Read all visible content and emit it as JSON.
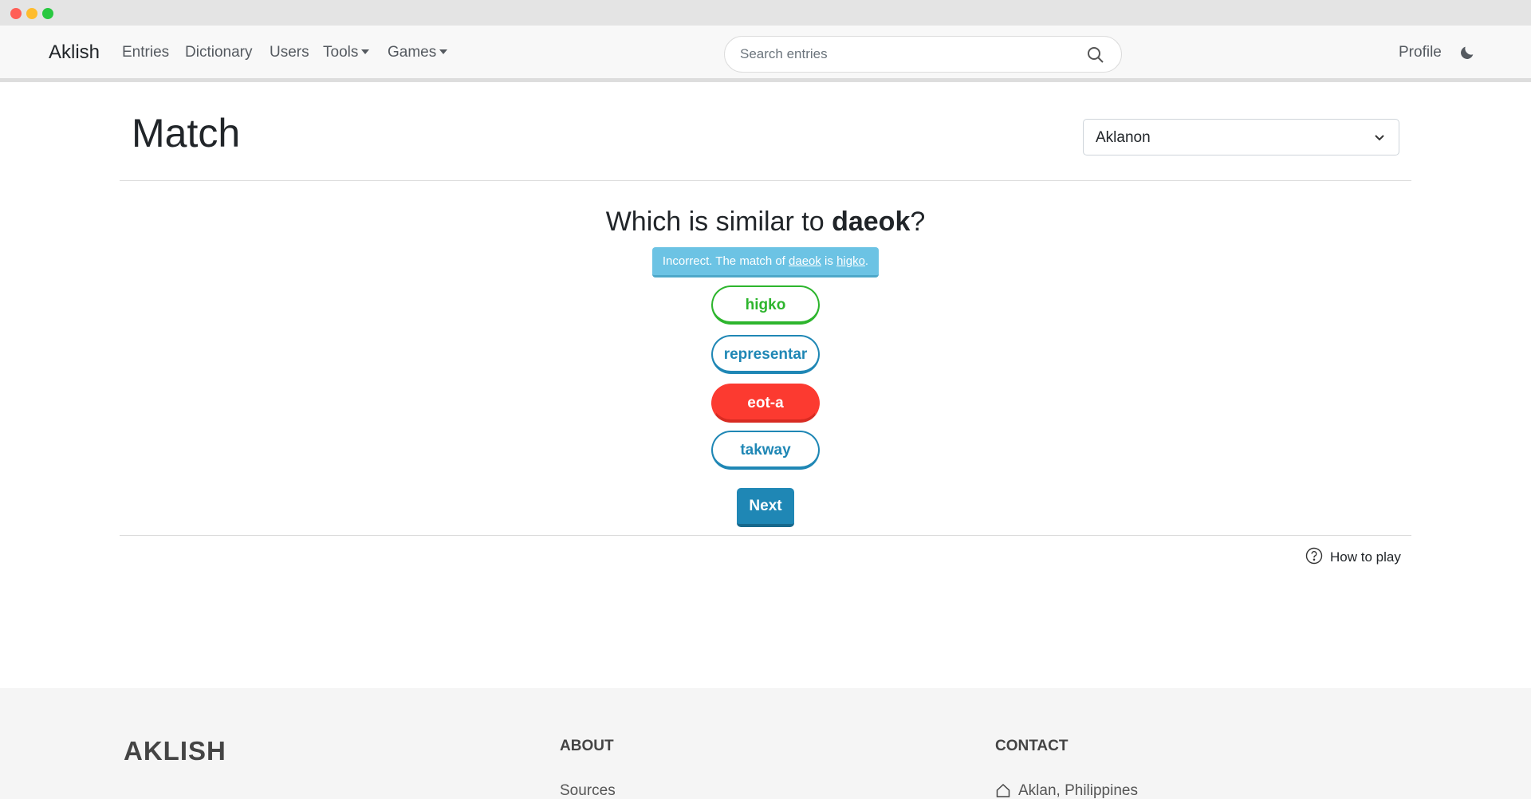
{
  "navbar": {
    "brand": "Aklish",
    "links": [
      "Entries",
      "Dictionary",
      "Users",
      "Tools",
      "Games"
    ],
    "search_placeholder": "Search entries",
    "profile": "Profile",
    "icons": {
      "search": "search-icon",
      "theme": "moon-icon"
    }
  },
  "page": {
    "title": "Match",
    "language_select": "Aklanon"
  },
  "game": {
    "question_prefix": "Which is similar to ",
    "word": "daeok",
    "question_suffix": "?",
    "feedback": {
      "prefix": "Incorrect. The match of ",
      "word": "daeok",
      "middle": " is ",
      "answer": "higko",
      "suffix": "."
    },
    "choices": [
      {
        "label": "higko",
        "state": "correct"
      },
      {
        "label": "representar",
        "state": "neutral"
      },
      {
        "label": "eot-a",
        "state": "wrong"
      },
      {
        "label": "takway",
        "state": "neutral"
      }
    ],
    "next_label": "Next",
    "how_to_play": "How to play"
  },
  "footer": {
    "brand": "AKLISH",
    "about_heading": "ABOUT",
    "about_link": "Sources",
    "contact_heading": "CONTACT",
    "contact_location": "Aklan, Philippines"
  },
  "colors": {
    "correct": "#2db52d",
    "neutral": "#1f87b5",
    "wrong": "#fc3a30",
    "alert": "#6cc3e4"
  }
}
